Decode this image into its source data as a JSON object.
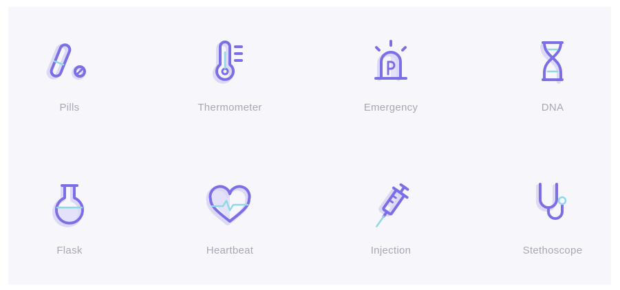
{
  "colors": {
    "background": "#f6f6fb",
    "icon_stroke": "#7c6fe6",
    "icon_shadow": "#dcd9f7",
    "accent": "#8fd8e6",
    "label": "#a7a7b5"
  },
  "icons": [
    {
      "label": "Pills",
      "icon": "pills-icon"
    },
    {
      "label": "Thermometer",
      "icon": "thermometer-icon"
    },
    {
      "label": "Emergency",
      "icon": "emergency-light-icon"
    },
    {
      "label": "DNA",
      "icon": "dna-icon"
    },
    {
      "label": "Flask",
      "icon": "flask-icon"
    },
    {
      "label": "Heartbeat",
      "icon": "heartbeat-icon"
    },
    {
      "label": "Injection",
      "icon": "syringe-icon"
    },
    {
      "label": "Stethoscope",
      "icon": "stethoscope-icon"
    }
  ]
}
